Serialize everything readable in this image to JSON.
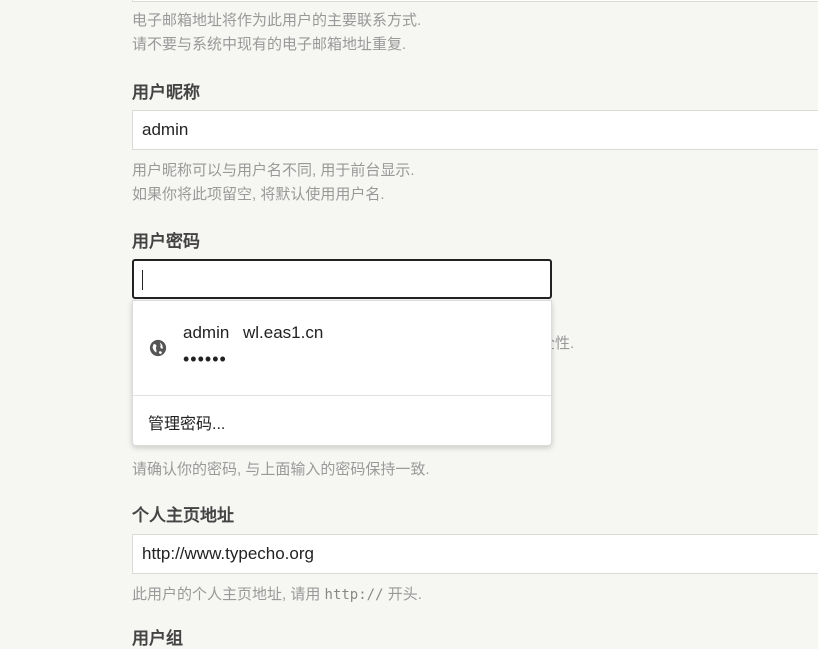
{
  "email": {
    "desc_line1": "电子邮箱地址将作为此用户的主要联系方式.",
    "desc_line2": "请不要与系统中现有的电子邮箱地址重复."
  },
  "nickname": {
    "label": "用户昵称",
    "value": "admin",
    "desc_line1": "用户昵称可以与用户名不同, 用于前台显示.",
    "desc_line2": "如果你将此项留空, 将默认使用用户名."
  },
  "password": {
    "label": "用户密码",
    "value": "",
    "hidden_desc_tail": "全性."
  },
  "autofill": {
    "username": "admin",
    "site": "wl.eas1.cn",
    "masked_password": "••••••",
    "manage_label": "管理密码..."
  },
  "confirm_password": {
    "desc": "请确认你的密码, 与上面输入的密码保持一致."
  },
  "homepage": {
    "label": "个人主页地址",
    "value": "http://www.typecho.org",
    "desc_prefix": "此用户的个人主页地址, 请用 ",
    "desc_code": "http://",
    "desc_suffix": " 开头."
  },
  "next_section": {
    "label": "用户组"
  },
  "icons": {
    "site": "globe-icon"
  }
}
